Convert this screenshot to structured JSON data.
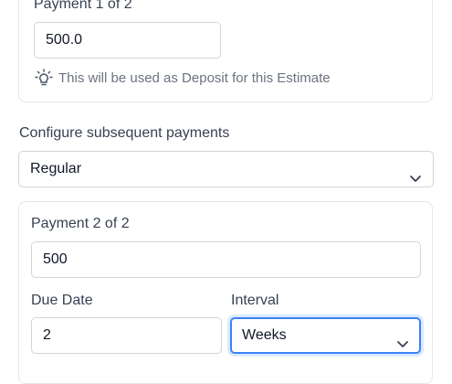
{
  "first_payment": {
    "title": "Payment 1 of 2",
    "amount_value": "500.0",
    "hint_text": "This will be used as Deposit for this Estimate",
    "hint_icon": "lightbulb-icon"
  },
  "subsequent": {
    "label": "Configure subsequent payments",
    "selected": "Regular",
    "icon": "chevron-down-icon"
  },
  "second_payment": {
    "title": "Payment 2 of 2",
    "amount_value": "500",
    "due_date_label": "Due Date",
    "due_date_value": "2",
    "interval_label": "Interval",
    "interval_selected": "Weeks"
  },
  "colors": {
    "focus_border": "#3b82f6",
    "border": "#d1d5db",
    "muted_text": "#6b7280"
  }
}
